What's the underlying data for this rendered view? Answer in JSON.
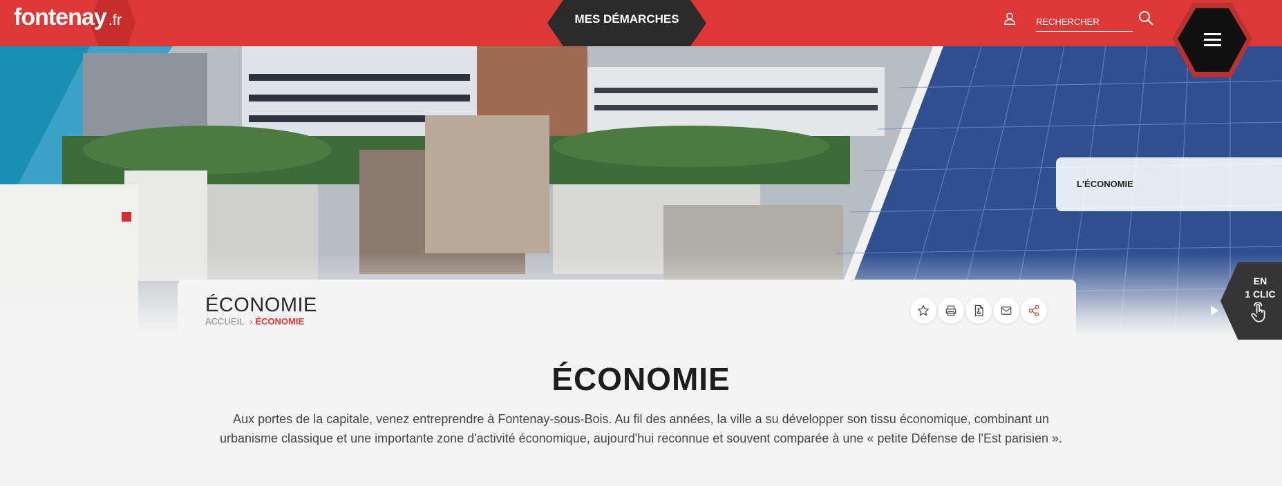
{
  "header": {
    "logo_main": "fontenay",
    "logo_tld": ".fr",
    "demarches_label": "MES DÉMARCHES",
    "search_placeholder": "RECHERCHER"
  },
  "hero": {
    "side_card_label": "L'ÉCONOMIE",
    "en_un_clic": [
      "EN",
      "1 CLIC"
    ]
  },
  "page": {
    "title": "ÉCONOMIE",
    "breadcrumb": {
      "home": "ACCUEIL",
      "separator": "›",
      "current": "ÉCONOMIE"
    }
  },
  "tools": [
    {
      "icon": "star-icon",
      "name": "favorite-button"
    },
    {
      "icon": "print-icon",
      "name": "print-button"
    },
    {
      "icon": "pdf-icon",
      "name": "pdf-button"
    },
    {
      "icon": "mail-icon",
      "name": "mail-button"
    },
    {
      "icon": "share-icon",
      "name": "share-button"
    }
  ],
  "content": {
    "heading": "ÉCONOMIE",
    "intro": "Aux portes de la capitale, venez entreprendre à Fontenay-sous-Bois. Au fil des années, la ville a su développer son tissu économique, combinant un urbanisme classique et une importante zone d'activité économique, aujourd'hui reconnue et souvent comparée à une « petite Défense de l'Est parisien »."
  },
  "colors": {
    "brand_red": "#dd3838",
    "dark": "#2b2b2b",
    "accent_blue": "#1a8fb3",
    "background": "#f4f4f4"
  }
}
